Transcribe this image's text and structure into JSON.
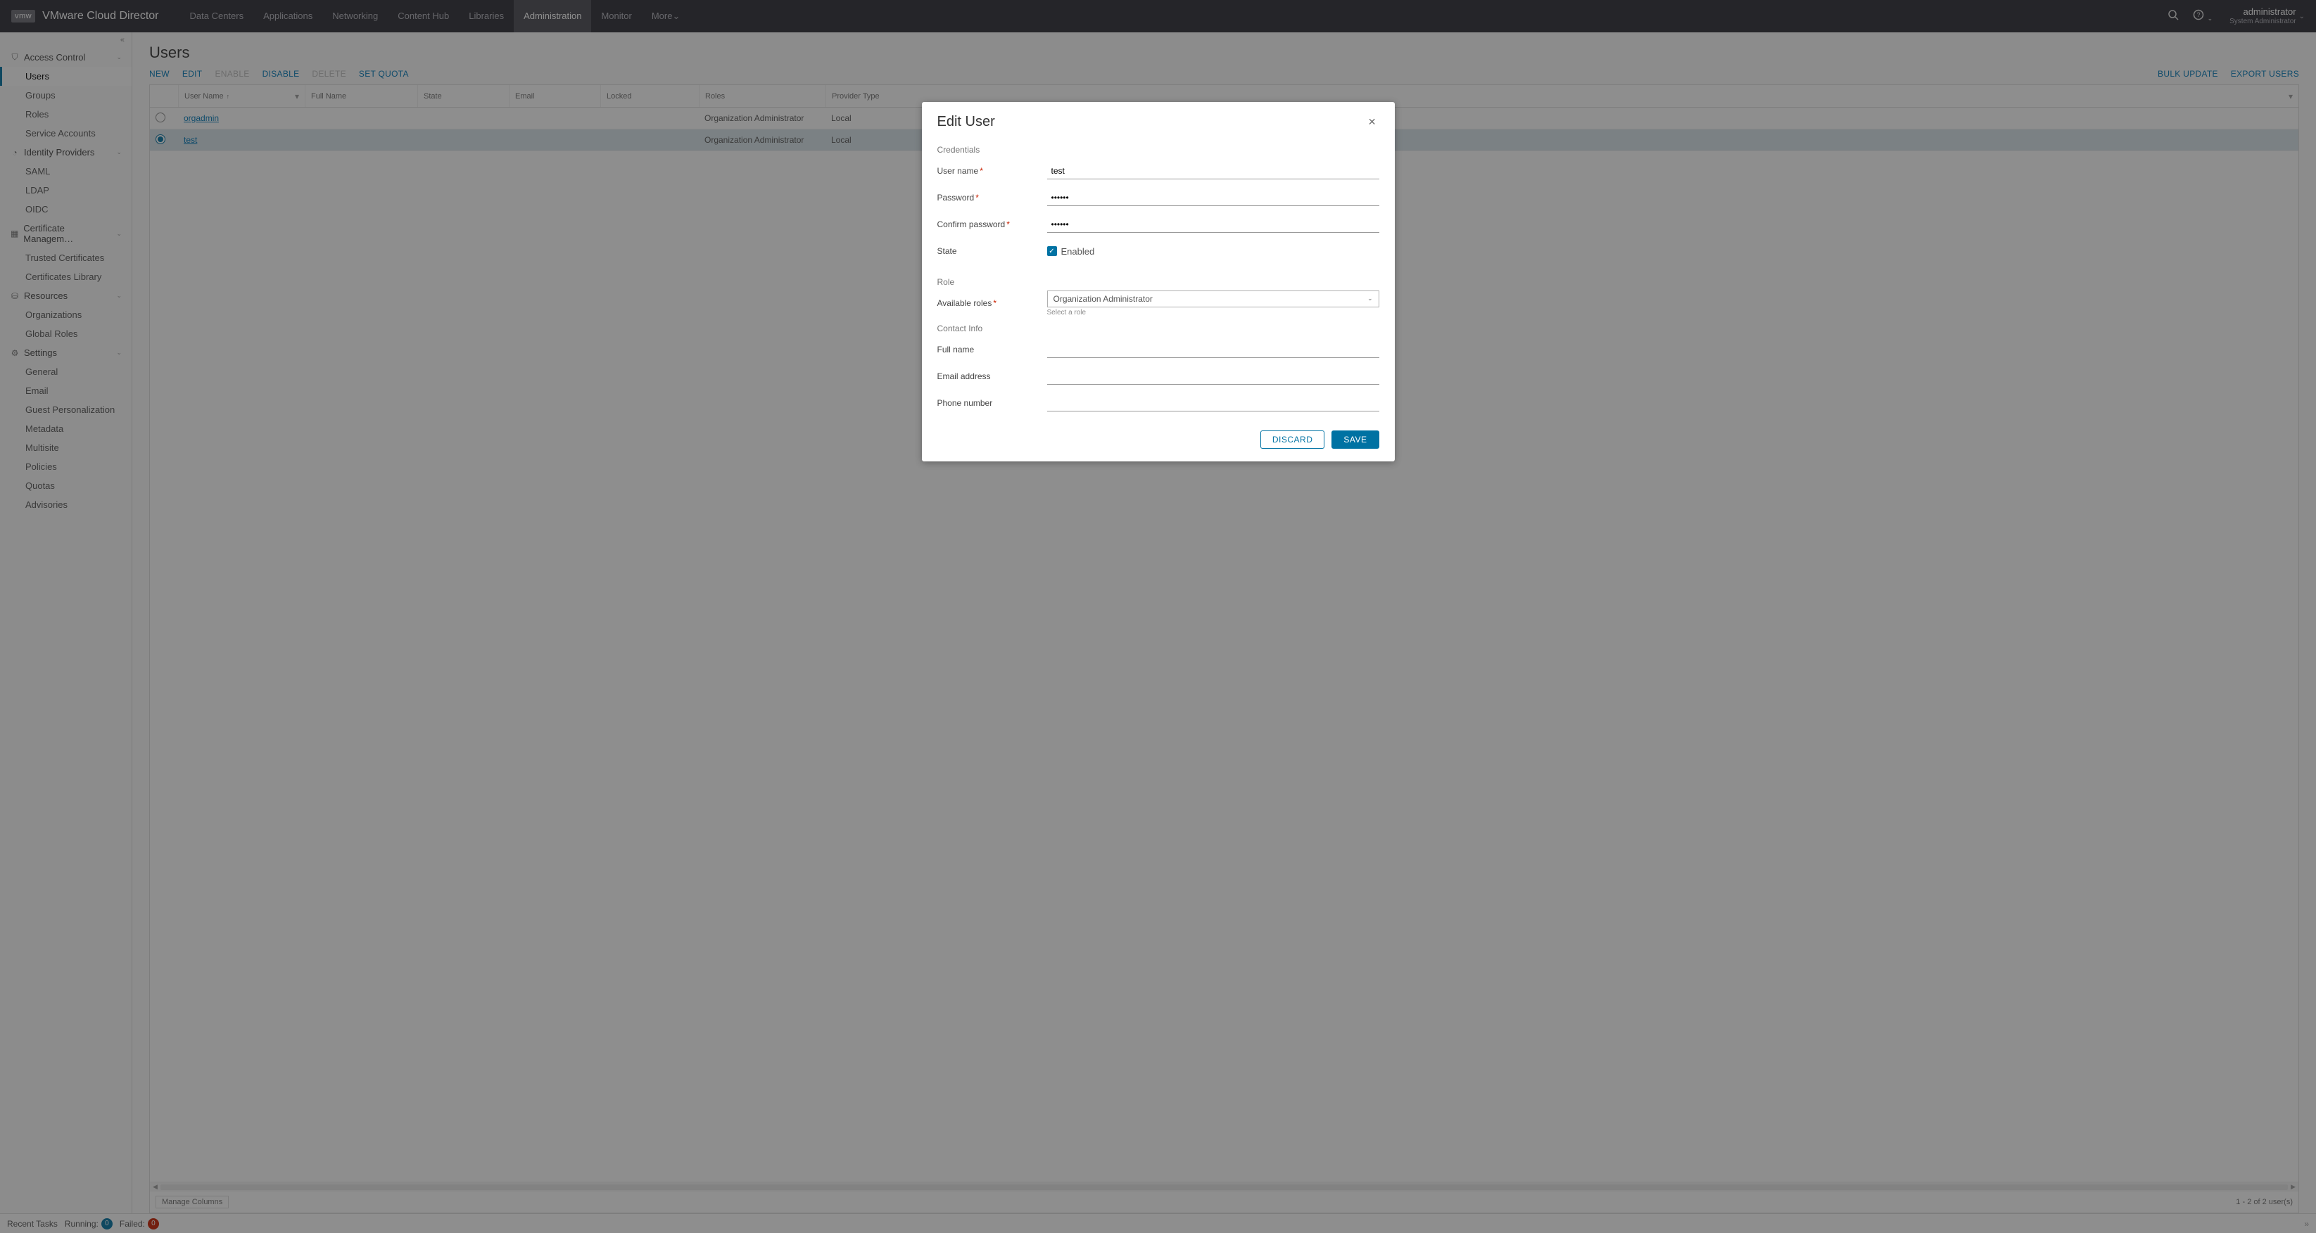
{
  "header": {
    "logo": "vmw",
    "product": "VMware Cloud Director",
    "nav": [
      "Data Centers",
      "Applications",
      "Networking",
      "Content Hub",
      "Libraries",
      "Administration",
      "Monitor",
      "More"
    ],
    "more_caret": "⌄",
    "active_nav": "Administration",
    "user": {
      "name": "administrator",
      "role": "System Administrator"
    }
  },
  "sidebar": {
    "sections": [
      {
        "label": "Access Control",
        "icon": "👥",
        "items": [
          "Users",
          "Groups",
          "Roles",
          "Service Accounts"
        ],
        "active_item": "Users"
      },
      {
        "label": "Identity Providers",
        "icon": "👤",
        "items": [
          "SAML",
          "LDAP",
          "OIDC"
        ]
      },
      {
        "label": "Certificate Managem…",
        "icon": "▦",
        "items": [
          "Trusted Certificates",
          "Certificates Library"
        ]
      },
      {
        "label": "Resources",
        "icon": "⚙",
        "items": [
          "Organizations",
          "Global Roles"
        ]
      },
      {
        "label": "Settings",
        "icon": "⚙",
        "items": [
          "General",
          "Email",
          "Guest Personalization",
          "Metadata",
          "Multisite",
          "Policies",
          "Quotas",
          "Advisories"
        ]
      }
    ]
  },
  "page": {
    "title": "Users",
    "toolbar": {
      "new": "NEW",
      "edit": "EDIT",
      "enable": "ENABLE",
      "disable": "DISABLE",
      "delete": "DELETE",
      "set_quota": "SET QUOTA",
      "bulk_update": "BULK UPDATE",
      "export": "EXPORT USERS"
    },
    "columns": [
      "User Name",
      "Full Name",
      "State",
      "Email",
      "Locked",
      "Roles",
      "Provider Type"
    ],
    "sort_col": "User Name",
    "rows": [
      {
        "selected": false,
        "user_name": "orgadmin",
        "full_name": "",
        "state": "",
        "email": "",
        "locked": "",
        "roles": "Organization Administrator",
        "provider": "Local"
      },
      {
        "selected": true,
        "user_name": "test",
        "full_name": "",
        "state": "",
        "email": "",
        "locked": "",
        "roles": "Organization Administrator",
        "provider": "Local"
      }
    ],
    "manage_columns": "Manage Columns",
    "pager": "1 - 2 of 2 user(s)"
  },
  "tasks": {
    "label": "Recent Tasks",
    "running_label": "Running:",
    "running_count": "0",
    "failed_label": "Failed:",
    "failed_count": "0"
  },
  "modal": {
    "title": "Edit User",
    "section_credentials": "Credentials",
    "username_label": "User name",
    "username_value": "test",
    "password_label": "Password",
    "password_value": "••••••",
    "confirm_label": "Confirm password",
    "confirm_value": "••••••",
    "state_label": "State",
    "enabled_label": "Enabled",
    "section_role": "Role",
    "roles_label": "Available roles",
    "roles_value": "Organization Administrator",
    "roles_helper": "Select a role",
    "section_contact": "Contact Info",
    "fullname_label": "Full name",
    "fullname_value": "",
    "email_label": "Email address",
    "email_value": "",
    "phone_label": "Phone number",
    "phone_value": "",
    "discard": "DISCARD",
    "save": "SAVE"
  }
}
